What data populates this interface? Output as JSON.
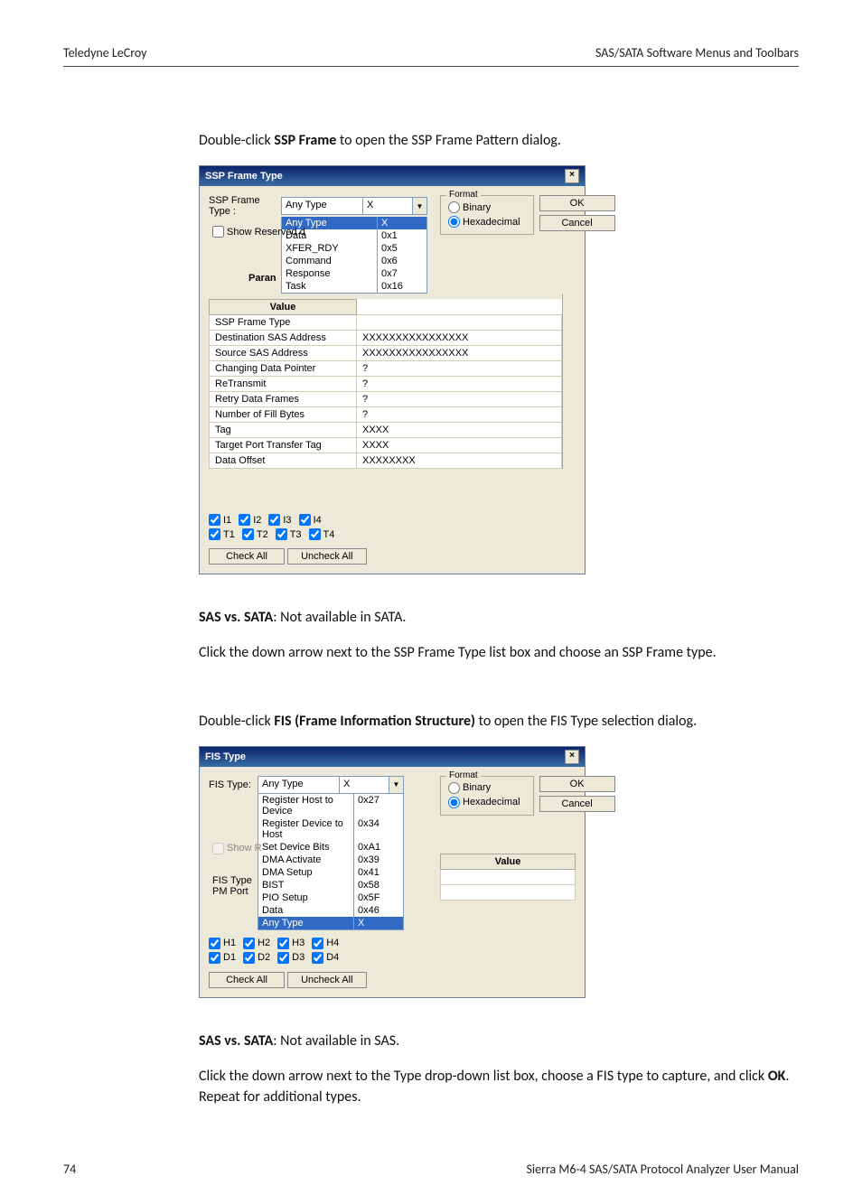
{
  "header": {
    "left": "Teledyne LeCroy",
    "right": "SAS/SATA Software Menus and Toolbars"
  },
  "para1_pre": "Double-click ",
  "para1_bold": "SSP Frame",
  "para1_post": " to open the SSP Frame Pattern dialog.",
  "ssp": {
    "title": "SSP Frame Type",
    "labelFrameType": "SSP Frame Type :",
    "selected": {
      "name": "Any Type",
      "value": "X"
    },
    "options": [
      {
        "name": "Any Type",
        "value": "X",
        "hl": true
      },
      {
        "name": "Data",
        "value": "0x1"
      },
      {
        "name": "XFER_RDY",
        "value": "0x5"
      },
      {
        "name": "Command",
        "value": "0x6"
      },
      {
        "name": "Response",
        "value": "0x7"
      },
      {
        "name": "Task",
        "value": "0x16"
      }
    ],
    "showReserved": "Show Reserved d",
    "paramPrefix": "Paran",
    "valueHeader": "Value",
    "rows": [
      {
        "p": "SSP Frame Type",
        "v": ""
      },
      {
        "p": "Destination SAS Address",
        "v": "XXXXXXXXXXXXXXXX"
      },
      {
        "p": "Source SAS Address",
        "v": "XXXXXXXXXXXXXXXX"
      },
      {
        "p": "Changing Data Pointer",
        "v": "?"
      },
      {
        "p": "ReTransmit",
        "v": "?"
      },
      {
        "p": "Retry Data Frames",
        "v": "?"
      },
      {
        "p": "Number of Fill Bytes",
        "v": "?"
      },
      {
        "p": "Tag",
        "v": "XXXX"
      },
      {
        "p": "Target Port Transfer Tag",
        "v": "XXXX"
      },
      {
        "p": "Data Offset",
        "v": "XXXXXXXX"
      }
    ],
    "ports": {
      "i": [
        "I1",
        "I2",
        "I3",
        "I4"
      ],
      "t": [
        "T1",
        "T2",
        "T3",
        "T4"
      ]
    },
    "checkAll": "Check All",
    "uncheckAll": "Uncheck All",
    "format": {
      "title": "Format",
      "binary": "Binary",
      "hex": "Hexadecimal"
    },
    "ok": "OK",
    "cancel": "Cancel"
  },
  "sas_sata_pre": "SAS vs. SATA",
  "sas_sata_sata_post": ": Not available in SATA.",
  "para2": "Click the down arrow next to the SSP Frame Type list box and choose an SSP Frame type.",
  "para3_pre": "Double-click ",
  "para3_bold": "FIS (Frame Information Structure)",
  "para3_post": " to open the FIS Type selection dialog.",
  "fis": {
    "title": "FIS Type",
    "labelType": "FIS Type:",
    "selected": {
      "name": "Any Type",
      "value": "X"
    },
    "options": [
      {
        "name": "Register Host to Device",
        "value": "0x27"
      },
      {
        "name": "Register Device to Host",
        "value": "0x34"
      },
      {
        "name": "Set Device Bits",
        "value": "0xA1"
      },
      {
        "name": "DMA Activate",
        "value": "0x39"
      },
      {
        "name": "DMA Setup",
        "value": "0x41"
      },
      {
        "name": "BIST",
        "value": "0x58"
      },
      {
        "name": "PIO Setup",
        "value": "0x5F"
      },
      {
        "name": "Data",
        "value": "0x46"
      },
      {
        "name": "Any Type",
        "value": "X",
        "hl": true
      }
    ],
    "showReserved": "Show R",
    "valueHeader": "Value",
    "rows": [
      {
        "p": "FIS Type",
        "v": ""
      },
      {
        "p": "PM Port",
        "v": ""
      }
    ],
    "ports": {
      "h": [
        "H1",
        "H2",
        "H3",
        "H4"
      ],
      "d": [
        "D1",
        "D2",
        "D3",
        "D4"
      ]
    },
    "checkAll": "Check All",
    "uncheckAll": "Uncheck All",
    "format": {
      "title": "Format",
      "binary": "Binary",
      "hex": "Hexadecimal"
    },
    "ok": "OK",
    "cancel": "Cancel"
  },
  "sas_sata_sas_post": ": Not available in SAS.",
  "para4_a": "Click the down arrow next to the Type drop-down list box, choose a FIS type to capture, and click ",
  "para4_b": "OK",
  "para4_c": ". Repeat for additional types.",
  "footer": {
    "left": "74",
    "right": "Sierra M6-4 SAS/SATA Protocol Analyzer User Manual"
  }
}
